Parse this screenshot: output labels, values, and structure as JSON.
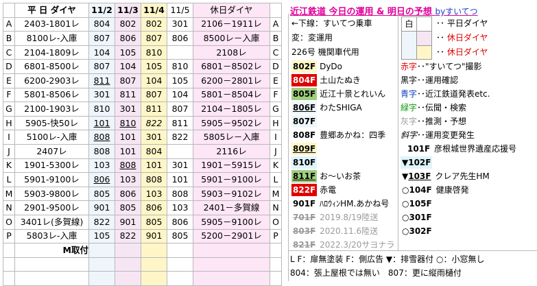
{
  "header": {
    "weekday_label": "平 日 ダイヤ",
    "dates": [
      "11/2",
      "11/3",
      "11/4",
      "11/5"
    ],
    "holiday_label": "休日ダイヤ"
  },
  "rows": [
    {
      "label": "A",
      "weekday": "2403-1801レ",
      "d1": "804",
      "d2": "802",
      "d3": "802",
      "d4": "301",
      "holiday": "2106－1911レ"
    },
    {
      "label": "B",
      "weekday": "8100レ-入庫",
      "d1": "807",
      "d2": "806",
      "d3": "807",
      "d4": "806",
      "holiday": "8500レ－入庫"
    },
    {
      "label": "C",
      "weekday": "2104-1809レ",
      "d1": "104",
      "d2": "105",
      "d3": "810",
      "d4": "",
      "holiday": "2108レ"
    },
    {
      "label": "D",
      "weekday": "6801-8500レ",
      "d1": "807",
      "d2": "104",
      "d3": "105",
      "d4": "810",
      "holiday": "6801－8502レ"
    },
    {
      "label": "E",
      "weekday": "6200-2903レ",
      "d1": "811",
      "d2": "807",
      "d3": "104",
      "d4": "105",
      "holiday": "6200－2801レ"
    },
    {
      "label": "F",
      "weekday": "5801-8506レ",
      "d1": "301",
      "d2": "811",
      "d3": "807",
      "d4": "104",
      "holiday": "5801－8504レ"
    },
    {
      "label": "G",
      "weekday": "2100-1903レ",
      "d1": "810",
      "d2": "301",
      "d3": "811",
      "d4": "807",
      "holiday": "2104－1805レ"
    },
    {
      "label": "H",
      "weekday": "5905-快50レ",
      "d1": "101",
      "d2": "810",
      "d3": "822",
      "d4": "811",
      "holiday": "5905－9502レ"
    },
    {
      "label": "I",
      "weekday": "5100レ-入庫",
      "d1": "808",
      "d2": "101",
      "d3": "301",
      "d4": "822",
      "holiday": "5805レ－入庫"
    },
    {
      "label": "J",
      "weekday": "2407レ",
      "d1": "808",
      "d2": "101",
      "d3": "804",
      "d4": "",
      "holiday": "2116レ"
    },
    {
      "label": "K",
      "weekday": "1901-5300レ",
      "d1": "103",
      "d2": "808",
      "d3": "101",
      "d4": "301",
      "holiday": "1901－5915レ"
    },
    {
      "label": "L",
      "weekday": "5901-9100レ",
      "d1": "806",
      "d2": "103",
      "d3": "808",
      "d4": "101",
      "holiday": "5901－9100レ"
    },
    {
      "label": "M",
      "weekday": "5903-9800レ",
      "d1": "805",
      "d2": "806",
      "d3": "103",
      "d4": "808",
      "holiday": "5903－9102レ"
    },
    {
      "label": "N",
      "weekday": "2901-9500レ",
      "d1": "901",
      "d2": "805",
      "d3": "806",
      "d4": "103",
      "holiday": "2401－多賀線"
    },
    {
      "label": "O",
      "weekday": "3401レ(多賀線)",
      "d1": "822",
      "d2": "901",
      "d3": "805",
      "d4": "806",
      "holiday": "5905－9100レ"
    },
    {
      "label": "P",
      "weekday": "5803レ-入庫",
      "d1": "105",
      "d2": "822",
      "d3": "901",
      "d4": "805",
      "holiday": "5200－2901レ"
    }
  ],
  "footer": {
    "note": "M取付"
  },
  "panel": {
    "title": "近江鉄道 今日の運用 & 明日の予想",
    "by": "byすいてつ",
    "legend_top": [
      "←下線：すいてつ乗車",
      "変：変運用",
      "226号 機関車代用"
    ],
    "box_labels": {
      "white": "白",
      "pink": "ピ",
      "yellow": "黄"
    },
    "box_desc": [
      "平日ダイヤ",
      "休日ダイヤ",
      "休日ダイヤ"
    ],
    "trains": [
      {
        "no": "802F",
        "name": "DyDo"
      },
      {
        "no": "804F",
        "name": "土山たぬき"
      },
      {
        "no": "805F",
        "name": "近江十景とれいん"
      },
      {
        "no": "806F",
        "name": "わたSHIGA"
      },
      {
        "no": "807F",
        "name": ""
      },
      {
        "no": "808F",
        "name": "豊郷あかね：四季"
      },
      {
        "no": "809F",
        "name": ""
      },
      {
        "no": "810F",
        "name": ""
      },
      {
        "no": "811F",
        "name": "お～いお茶"
      },
      {
        "no": "822F",
        "name": "赤電"
      },
      {
        "no": "901F",
        "name": "ﾊﾛｳｨﾝHM.あかね号"
      },
      {
        "no": "701F",
        "name": "2019.8/19陸送"
      },
      {
        "no": "803F",
        "name": "2020.11.6陸送"
      },
      {
        "no": "821F",
        "name": "2022.3/20サヨナラ"
      }
    ],
    "colors": [
      {
        "key": "赤字",
        "desc": "\"すいてつ\"撮影"
      },
      {
        "key": "黒字",
        "desc": "運用確認"
      },
      {
        "key": "青字",
        "desc": "近江鉄道発表etc."
      },
      {
        "key": "緑字",
        "desc": "伝聞・検索"
      },
      {
        "key": "灰字",
        "desc": "推測・予想"
      },
      {
        "key": "斜字",
        "desc": "運用変更発生"
      }
    ],
    "others": [
      {
        "no": "101F",
        "name": "彦根城世界遺産応援号"
      },
      {
        "no": "102F",
        "name": ""
      },
      {
        "no": "103F",
        "name": "クレア先生HM"
      },
      {
        "no": "104F",
        "name": "健康啓発"
      },
      {
        "no": "105F",
        "name": ""
      },
      {
        "no": "301F",
        "name": ""
      },
      {
        "no": "302F",
        "name": ""
      }
    ],
    "legend_bottom1": "L F：扉無塗装  F：側広告  ▼：排雪器付  ○：小窓無し",
    "legend_bottom2a": "804：張上屋根では無い",
    "legend_bottom2b": "807：更に縦雨樋付"
  }
}
